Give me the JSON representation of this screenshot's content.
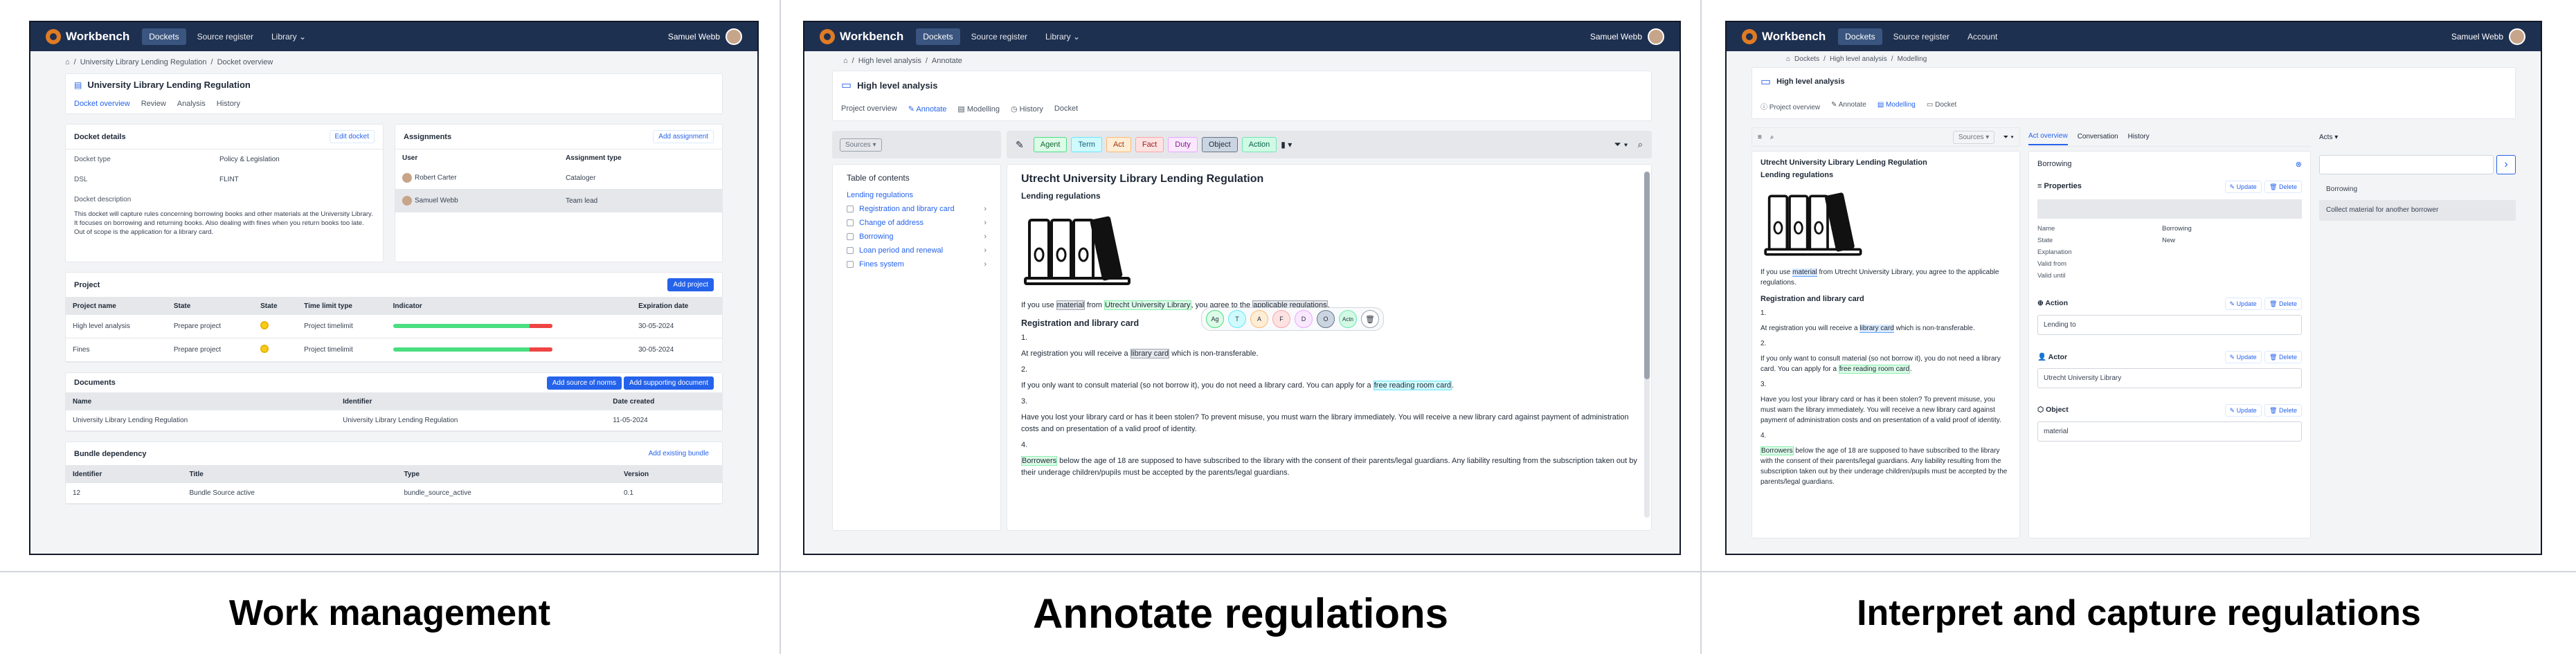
{
  "panels": [
    {
      "caption": "Work management",
      "app": {
        "brand": "Workbench",
        "nav": [
          "Dockets",
          "Source register",
          "Library"
        ],
        "active_nav": "Dockets",
        "user": "Samuel Webb"
      },
      "breadcrumb": [
        "University Library Lending Regulation",
        "Docket overview"
      ],
      "title": "University Library Lending Regulation",
      "tabs": [
        "Docket overview",
        "Review",
        "Analysis",
        "History"
      ],
      "docket_details": {
        "heading": "Docket details",
        "edit_label": "Edit docket",
        "fields": [
          {
            "k": "Docket type",
            "v": "Policy & Legislation"
          },
          {
            "k": "DSL",
            "v": "FLINT"
          },
          {
            "k": "Docket description",
            "v": ""
          }
        ],
        "description": "This docket will capture rules concerning borrowing books and other materials at the University Library. It focuses on borrowing and returning books. Also dealing with fines when you return books too late. Out of scope is the application for a library card."
      },
      "assignments": {
        "heading": "Assignments",
        "add_label": "Add assignment",
        "columns": [
          "User",
          "Assignment type"
        ],
        "rows": [
          {
            "user": "Robert Carter",
            "type": "Cataloger"
          },
          {
            "user": "Samuel Webb",
            "type": "Team lead"
          }
        ]
      },
      "project": {
        "heading": "Project",
        "add_label": "Add project",
        "columns": [
          "Project name",
          "State",
          "State",
          "Time limit type",
          "Indicator",
          "Expiration date"
        ],
        "rows": [
          {
            "name": "High level analysis",
            "state": "Prepare project",
            "limit": "Project timelimit",
            "progress": 0.86,
            "date": "30-05-2024"
          },
          {
            "name": "Fines",
            "state": "Prepare project",
            "limit": "Project timelimit",
            "progress": 0.86,
            "date": "30-05-2024"
          }
        ]
      },
      "documents": {
        "heading": "Documents",
        "btn1": "Add source of norms",
        "btn2": "Add supporting document",
        "columns": [
          "Name",
          "Identifier",
          "Date created"
        ],
        "rows": [
          {
            "name": "University Library Lending Regulation",
            "id": "University Library Lending Regulation",
            "date": "11-05-2024"
          }
        ]
      },
      "bundle": {
        "heading": "Bundle dependency",
        "add_label": "Add existing bundle",
        "columns": [
          "Identifier",
          "Title",
          "Type",
          "Version"
        ],
        "rows": [
          {
            "id": "12",
            "title": "Bundle Source active",
            "type": "bundle_source_active",
            "version": "0.1"
          }
        ]
      }
    },
    {
      "caption": "Annotate regulations",
      "app": {
        "brand": "Workbench",
        "nav": [
          "Dockets",
          "Source register",
          "Library"
        ],
        "active_nav": "Dockets",
        "user": "Samuel Webb"
      },
      "breadcrumb": [
        "High level analysis",
        "Annotate"
      ],
      "title": "High level analysis",
      "tabs": [
        "Project overview",
        "Annotate",
        "Modelling",
        "History",
        "Docket"
      ],
      "sources_label": "Sources",
      "chips": [
        "Agent",
        "Term",
        "Act",
        "Fact",
        "Duty",
        "Object",
        "Action"
      ],
      "toc": {
        "heading": "Table of contents",
        "root": "Lending regulations",
        "items": [
          "Registration and library card",
          "Change of address",
          "Borrowing",
          "Loan period and renewal",
          "Fines system"
        ]
      },
      "floating_chips": [
        "Ag",
        "T",
        "A",
        "F",
        "D",
        "O",
        "Actn"
      ],
      "doc": {
        "title": "Utrecht University Library Lending Regulation",
        "subtitle": "Lending regulations",
        "p1": [
          "If you use ",
          "material",
          " from ",
          "Utrecht University Library",
          ", you agree to the ",
          "applicable regulations",
          "."
        ],
        "h_reg": "Registration and library card",
        "n1": "1.",
        "p2": [
          "At registration you will receive a ",
          "library card",
          " which is non-transferable."
        ],
        "n2": "2.",
        "p3": [
          "If you only want to consult material (so not borrow it), you do not need a library card. You can apply for a ",
          "free reading room card",
          "."
        ],
        "n3": "3.",
        "p4": "Have you lost your library card or has it been stolen? To prevent misuse, you must warn the library immediately. You will receive a new library card against payment of administration costs and on presentation of a valid proof of identity.",
        "n4": "4.",
        "p5": [
          "Borrowers",
          " below the age of 18 are supposed to have subscribed to the library with the consent of their parents/legal guardians. Any liability resulting from the subscription taken out by their underage children/pupils must be accepted by the parents/legal guardians."
        ]
      }
    },
    {
      "caption": "Interpret and capture regulations",
      "app": {
        "brand": "Workbench",
        "nav": [
          "Dockets",
          "Source register",
          "Account"
        ],
        "active_nav": "Dockets",
        "user": "Samuel Webb"
      },
      "breadcrumb": [
        "Dockets",
        "High level analysis",
        "Modelling"
      ],
      "title": "High level analysis",
      "tabs": [
        "Project overview",
        "Annotate",
        "Modelling",
        "Docket"
      ],
      "sources_label": "Sources",
      "mid_tabs": [
        "Act overview",
        "Conversation",
        "History"
      ],
      "acts_label": "Acts",
      "act_name": "Borrowing",
      "properties": {
        "heading": "Properties",
        "update": "Update",
        "delete": "Delete",
        "fields": [
          {
            "k": "Name",
            "v": "Borrowing"
          },
          {
            "k": "State",
            "v": "New"
          },
          {
            "k": "Explanation",
            "v": ""
          },
          {
            "k": "Valid from",
            "v": ""
          },
          {
            "k": "Valid until",
            "v": ""
          }
        ]
      },
      "sections": [
        {
          "heading": "Action",
          "value": "Lending to"
        },
        {
          "heading": "Actor",
          "value": "Utrecht University Library"
        },
        {
          "heading": "Object",
          "value": "material"
        }
      ],
      "right_list": [
        "Borrowing",
        "Collect material for another borrower"
      ],
      "doc": {
        "title": "Utrecht University Library Lending Regulation",
        "subtitle": "Lending regulations",
        "p1": [
          "If you use ",
          "material",
          " from Utrecht University Library, you agree to the applicable regulations."
        ],
        "h_reg": "Registration and library card",
        "n1": "1.",
        "p2": [
          "At registration you will receive a ",
          "library card",
          " which is non-transferable."
        ],
        "n2": "2.",
        "p3": [
          "If you only want to consult material (so not borrow it), you do not need a library card. You can apply for a ",
          "free reading room card",
          "."
        ],
        "n3": "3.",
        "p4": "Have you lost your library card or has it been stolen? To prevent misuse, you must warn the library immediately. You will receive a new library card against payment of administration costs and on presentation of a valid proof of identity.",
        "n4": "4.",
        "p5": [
          "Borrowers",
          " below the age of 18 are supposed to have subscribed to the library with the consent of their parents/legal guardians. Any liability resulting from the subscription taken out by their underage children/pupils must be accepted by the parents/legal guardians."
        ]
      }
    }
  ],
  "colors": {
    "topbar": "#1e3050",
    "accent": "#2563eb",
    "logo": "#e07b24"
  }
}
